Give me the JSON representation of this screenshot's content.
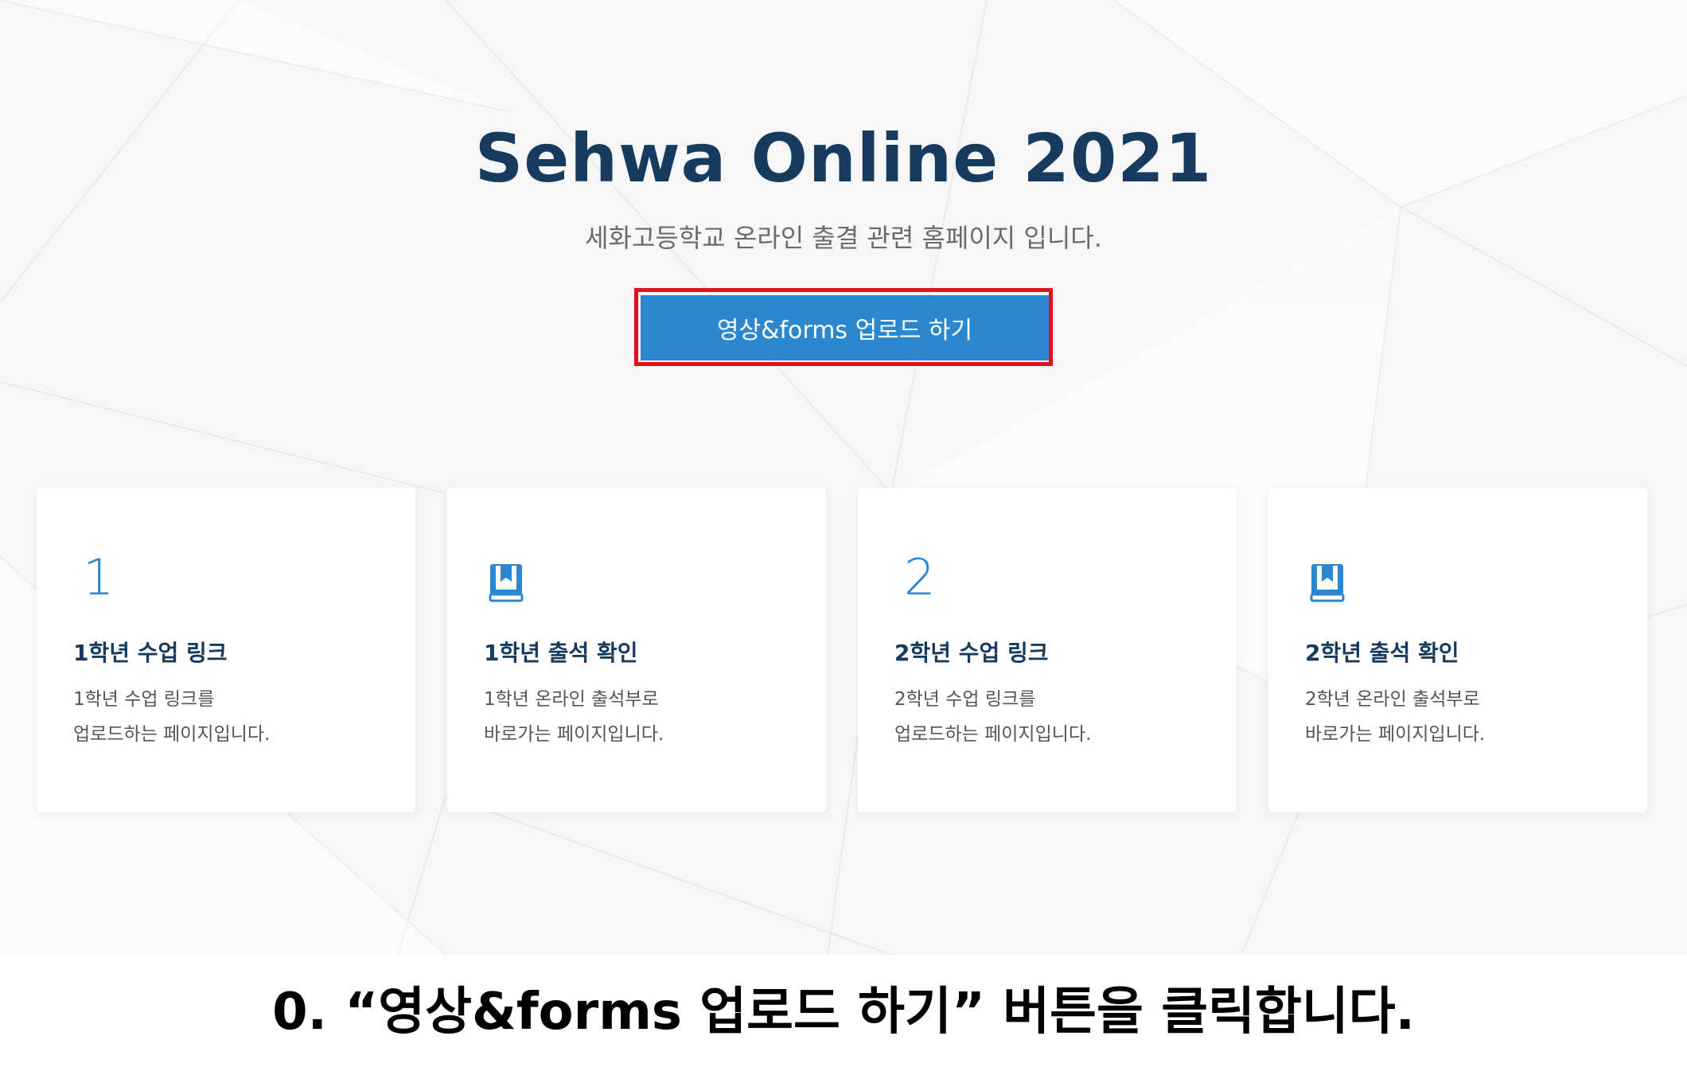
{
  "hero": {
    "title": "Sehwa Online 2021",
    "subtitle": "세화고등학교 온라인 출결 관련 홈페이지 입니다.",
    "cta_label": "영상&forms 업로드 하기",
    "accent_color": "#2a87d0",
    "title_color": "#173b5e",
    "highlight_color": "#e0121b"
  },
  "cards": [
    {
      "badge": "1",
      "icon": null,
      "title": "1학년 수업 링크",
      "line1": "1학년 수업 링크를",
      "line2": "업로드하는 페이지입니다."
    },
    {
      "badge": null,
      "icon": "book-icon",
      "title": "1학년 출석 확인",
      "line1": "1학년 온라인 출석부로",
      "line2": "바로가는 페이지입니다."
    },
    {
      "badge": "2",
      "icon": null,
      "title": "2학년 수업 링크",
      "line1": "2학년 수업 링크를",
      "line2": "업로드하는 페이지입니다."
    },
    {
      "badge": null,
      "icon": "book-icon",
      "title": "2학년 출석 확인",
      "line1": "2학년 온라인 출석부로",
      "line2": "바로가는 페이지입니다."
    }
  ],
  "instruction": "0. “영상&forms 업로드 하기” 버튼을 클릭합니다."
}
